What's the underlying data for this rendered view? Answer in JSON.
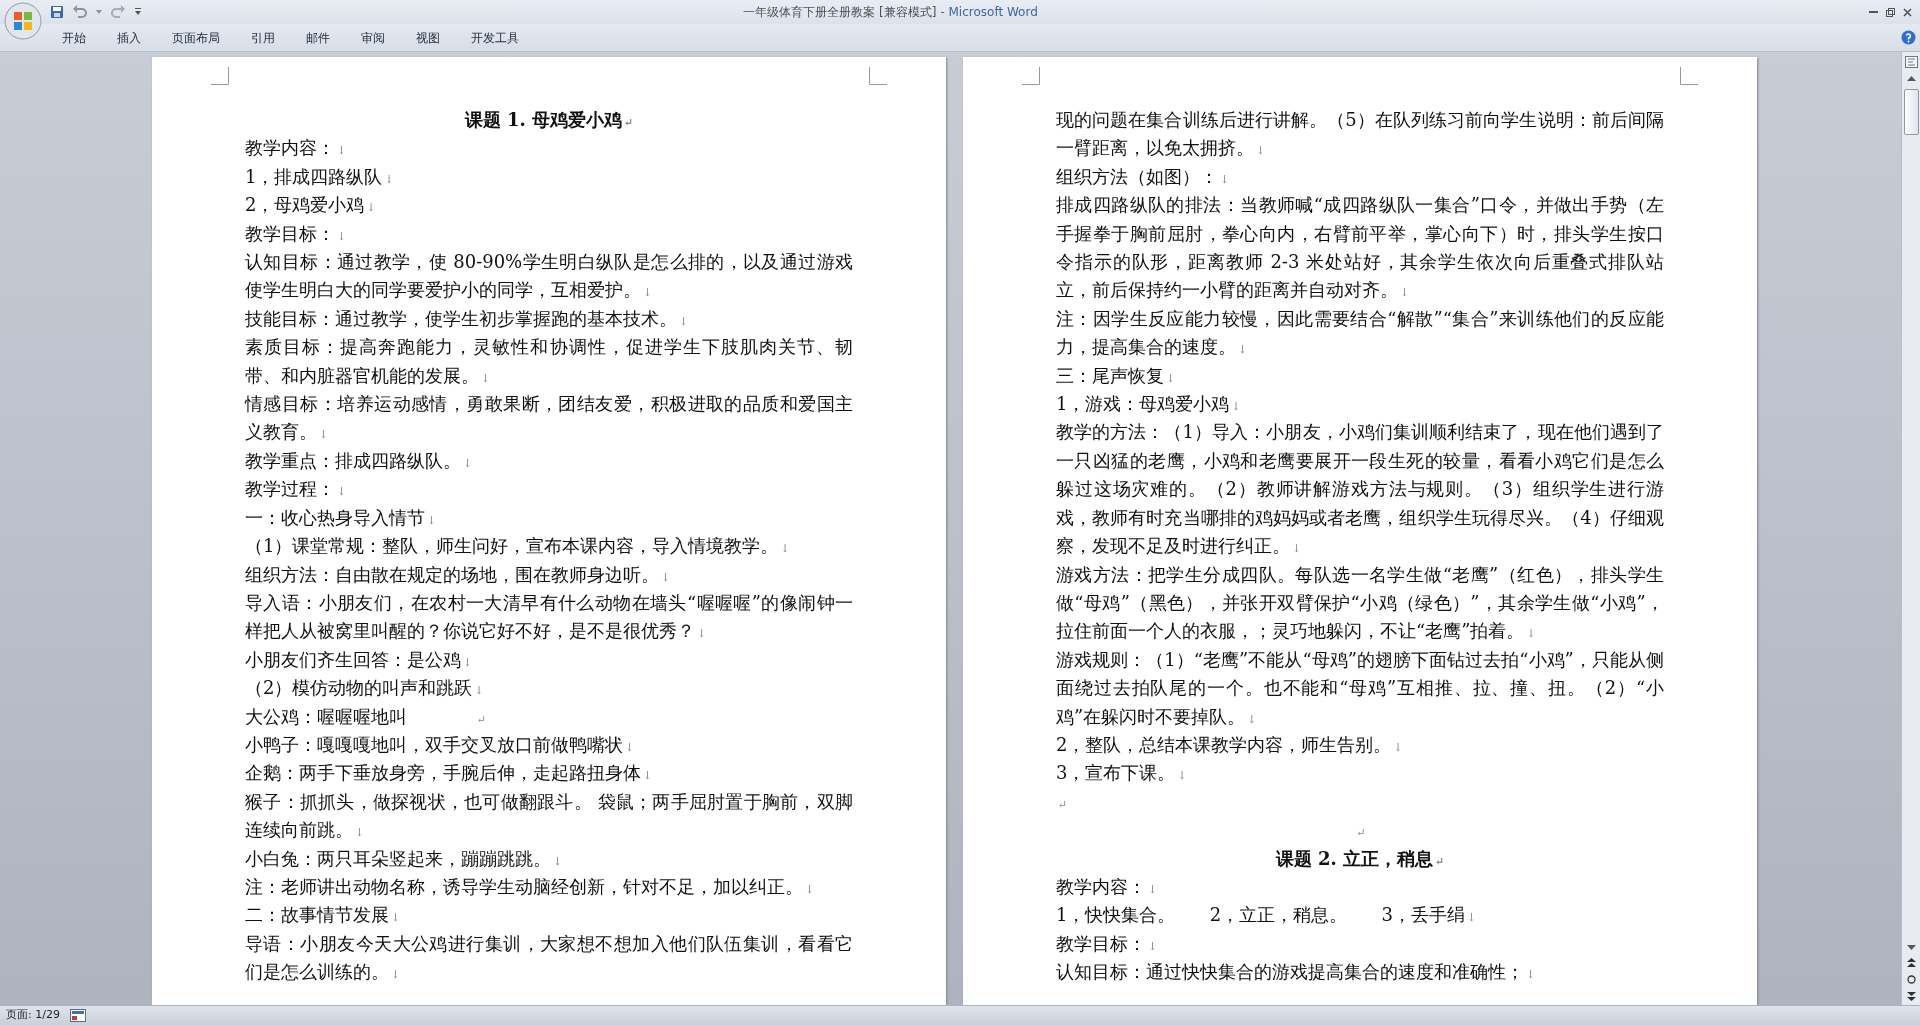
{
  "window": {
    "document_title": "一年级体育下册全册教案 [兼容模式]",
    "app_name": "- Microsoft Word"
  },
  "ribbon_tabs": [
    {
      "label": "开始",
      "selected": false
    },
    {
      "label": "插入",
      "selected": false
    },
    {
      "label": "页面布局",
      "selected": false
    },
    {
      "label": "引用",
      "selected": false
    },
    {
      "label": "邮件",
      "selected": false
    },
    {
      "label": "审阅",
      "selected": false
    },
    {
      "label": "视图",
      "selected": false
    },
    {
      "label": "开发工具",
      "selected": false
    }
  ],
  "pages": [
    {
      "paragraphs": [
        {
          "kind": "heading",
          "text": "课题 1. 母鸡爱小鸡",
          "mark": "↵"
        },
        {
          "kind": "body",
          "text": "教学内容：",
          "mark": "↓"
        },
        {
          "kind": "body",
          "text": "1，排成四路纵队",
          "mark": "↓"
        },
        {
          "kind": "body",
          "text": "2，母鸡爱小鸡",
          "mark": "↓"
        },
        {
          "kind": "body",
          "text": "教学目标：",
          "mark": "↓"
        },
        {
          "kind": "body",
          "text": "认知目标：通过教学，使 80-90%学生明白纵队是怎么排的，以及通过游戏使学生明白大的同学要爱护小的同学，互相爱护。",
          "mark": "↓"
        },
        {
          "kind": "body",
          "text": "技能目标：通过教学，使学生初步掌握跑的基本技术。",
          "mark": "↓"
        },
        {
          "kind": "body",
          "text": "素质目标：提高奔跑能力，灵敏性和协调性，促进学生下肢肌肉关节、韧带、和内脏器官机能的发展。",
          "mark": "↓"
        },
        {
          "kind": "body",
          "text": "情感目标：培养运动感情，勇敢果断，团结友爱，积极进取的品质和爱国主义教育。",
          "mark": "↓"
        },
        {
          "kind": "body",
          "text": "教学重点：排成四路纵队。",
          "mark": "↓"
        },
        {
          "kind": "body",
          "text": "教学过程：",
          "mark": "↓"
        },
        {
          "kind": "body",
          "text": "一：收心热身导入情节",
          "mark": "↓"
        },
        {
          "kind": "body",
          "text": "（1）课堂常规：整队，师生问好，宣布本课内容，导入情境教学。",
          "mark": "↓"
        },
        {
          "kind": "body",
          "text": "组织方法：自由散在规定的场地，围在教师身边听。",
          "mark": "↓"
        },
        {
          "kind": "body",
          "text": "导入语：小朋友们，在农村一大清早有什么动物在墙头“喔喔喔”的像闹钟一样把人从被窝里叫醒的？你说它好不好，是不是很优秀？",
          "mark": "↓"
        },
        {
          "kind": "body",
          "text": "小朋友们齐生回答：是公鸡",
          "mark": "↓"
        },
        {
          "kind": "body",
          "text": "（2）模仿动物的叫声和跳跃",
          "mark": "↓"
        },
        {
          "kind": "tabbed",
          "text": "大公鸡：喔喔喔地叫",
          "mark": "↵"
        },
        {
          "kind": "body",
          "text": "小鸭子：嘎嘎嘎地叫，双手交叉放口前做鸭嘴状",
          "mark": "↓"
        },
        {
          "kind": "body",
          "text": "企鹅：两手下垂放身旁，手腕后伸，走起路扭身体",
          "mark": "↓"
        },
        {
          "kind": "body",
          "text": "猴子：抓抓头，做探视状，也可做翻跟斗。 袋鼠；两手屈肘置于胸前，双脚连续向前跳。",
          "mark": "↓"
        },
        {
          "kind": "body",
          "text": "小白兔：两只耳朵竖起来，蹦蹦跳跳。",
          "mark": "↓"
        },
        {
          "kind": "body",
          "text": "注：老师讲出动物名称，诱导学生动脑经创新，针对不足，加以纠正。",
          "mark": "↓"
        },
        {
          "kind": "body",
          "text": "二：故事情节发展",
          "mark": "↓"
        },
        {
          "kind": "body",
          "text": "导语：小朋友今天大公鸡进行集训，大家想不想加入他们队伍集训，看看它们是怎么训练的。",
          "mark": "↓"
        }
      ]
    },
    {
      "paragraphs": [
        {
          "kind": "body",
          "text": "现的问题在集合训练后进行讲解。（5）在队列练习前向学生说明：前后间隔一臂距离，以免太拥挤。",
          "mark": "↓"
        },
        {
          "kind": "body",
          "text": "组织方法（如图）：",
          "mark": "↓"
        },
        {
          "kind": "body",
          "text": "排成四路纵队的排法：当教师喊“成四路纵队一集合”口令，并做出手势（左手握拳于胸前屈肘，拳心向内，右臂前平举，掌心向下）时，排头学生按口令指示的队形，距离教师 2-3 米处站好，其余学生依次向后重叠式排队站立，前后保持约一小臂的距离并自动对齐。",
          "mark": "↓"
        },
        {
          "kind": "body",
          "text": "注：因学生反应能力较慢，因此需要结合“解散”“集合”来训练他们的反应能力，提高集合的速度。",
          "mark": "↓"
        },
        {
          "kind": "body",
          "text": "三：尾声恢复",
          "mark": "↓"
        },
        {
          "kind": "body",
          "text": "1，游戏：母鸡爱小鸡",
          "mark": "↓"
        },
        {
          "kind": "body",
          "text": "教学的方法：（1）导入：小朋友，小鸡们集训顺利结束了，现在他们遇到了一只凶猛的老鹰，小鸡和老鹰要展开一段生死的较量，看看小鸡它们是怎么躲过这场灾难的。（2）教师讲解游戏方法与规则。（3）组织学生进行游戏，教师有时充当哪排的鸡妈妈或者老鹰，组织学生玩得尽兴。（4）仔细观察，发现不足及时进行纠正。",
          "mark": "↓"
        },
        {
          "kind": "body",
          "text": "游戏方法：把学生分成四队。每队选一名学生做“老鹰”（红色），排头学生做“母鸡”（黑色），并张开双臂保护“小鸡（绿色）”，其余学生做“小鸡”，拉住前面一个人的衣服，；灵巧地躲闪，不让“老鹰”拍着。",
          "mark": "↓"
        },
        {
          "kind": "body",
          "text": "游戏规则：（1）“老鹰”不能从“母鸡”的翅膀下面钻过去拍“小鸡”，只能从侧面绕过去拍队尾的一个。也不能和“母鸡”互相推、拉、撞、扭。（2）“小鸡”在躲闪时不要掉队。",
          "mark": "↓"
        },
        {
          "kind": "body",
          "text": "2，整队，总结本课教学内容，师生告别。",
          "mark": "↓"
        },
        {
          "kind": "body",
          "text": "3，宣布下课。",
          "mark": "↓"
        },
        {
          "kind": "empty",
          "mark": "↵"
        },
        {
          "kind": "empty_centered",
          "mark": "↵"
        },
        {
          "kind": "heading",
          "text": "课题 2. 立正，稍息",
          "mark": "↵"
        },
        {
          "kind": "body",
          "text": "教学内容：",
          "mark": "↓"
        },
        {
          "kind": "body",
          "text": "1，快快集合。      2，立正，稍息。      3，丢手绢",
          "mark": "↓"
        },
        {
          "kind": "body",
          "text": "教学目标：",
          "mark": "↓"
        },
        {
          "kind": "body",
          "text": "认知目标：通过快快集合的游戏提高集合的速度和准确性；",
          "mark": "↓"
        }
      ]
    }
  ],
  "status_bar": {
    "page": "页面: 1/29"
  }
}
